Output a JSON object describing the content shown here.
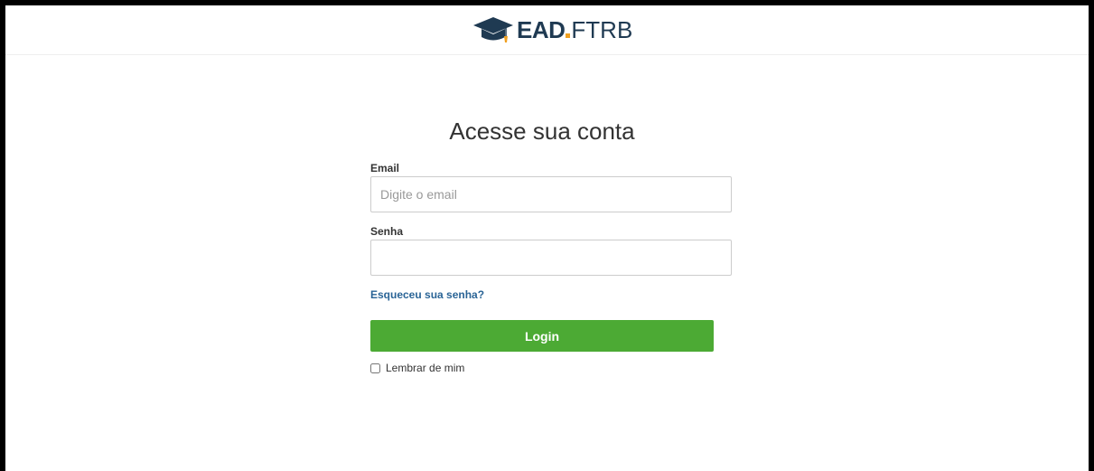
{
  "brand": {
    "logo_icon": "graduation-cap-icon",
    "name_bold": "EAD",
    "name_light": "FTRB",
    "colors": {
      "navy": "#1f3a52",
      "accent": "#f0a020"
    }
  },
  "form": {
    "title": "Acesse sua conta",
    "email_label": "Email",
    "email_placeholder": "Digite o email",
    "password_label": "Senha",
    "forgot_link": "Esqueceu sua senha?",
    "login_button": "Login",
    "remember_label": "Lembrar de mim"
  },
  "colors": {
    "button": "#4caa34",
    "link": "#2a6496"
  }
}
